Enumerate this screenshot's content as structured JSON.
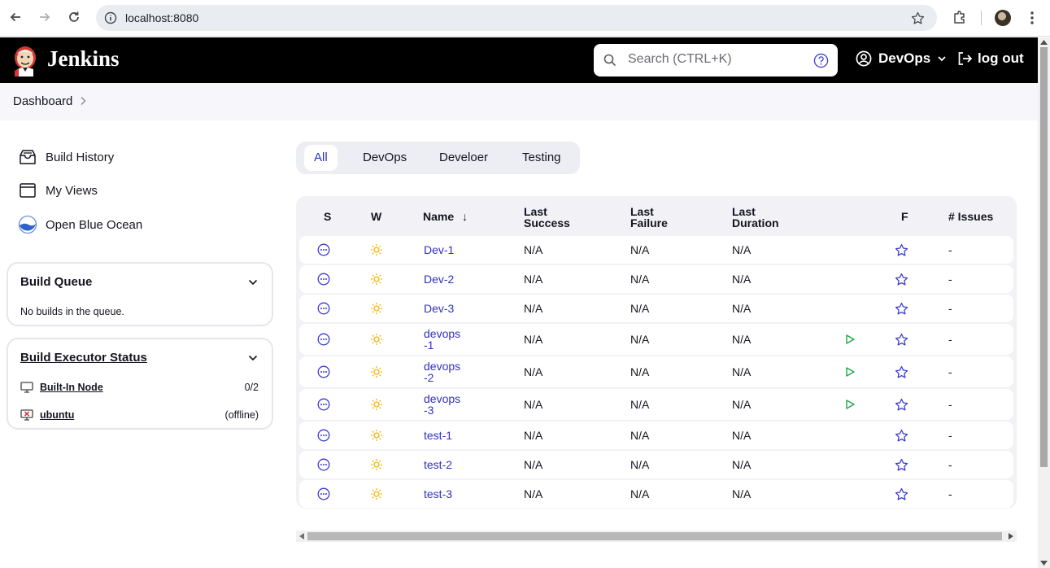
{
  "browser": {
    "url": "localhost:8080"
  },
  "header": {
    "title": "Jenkins",
    "search_placeholder": "Search (CTRL+K)",
    "user": "DevOps",
    "logout": "log out"
  },
  "breadcrumb": {
    "dashboard": "Dashboard"
  },
  "sidebar": {
    "tasks": [
      {
        "label": "Build History",
        "icon": "build-history-icon"
      },
      {
        "label": "My Views",
        "icon": "window-icon"
      },
      {
        "label": "Open Blue Ocean",
        "icon": "blue-ocean-icon"
      }
    ],
    "build_queue": {
      "title": "Build Queue",
      "empty_text": "No builds in the queue."
    },
    "executors": {
      "title": "Build Executor Status",
      "nodes": [
        {
          "name": "Built-In Node",
          "value": "0/2",
          "icon": "computer-icon"
        },
        {
          "name": "ubuntu",
          "value": "(offline)",
          "icon": "computer-offline-icon"
        }
      ]
    }
  },
  "tabs": [
    "All",
    "DevOps",
    "Develoer",
    "Testing"
  ],
  "active_tab": "All",
  "table": {
    "headers": {
      "s": "S",
      "w": "W",
      "name": "Name",
      "sort": "↓",
      "last_success": [
        "Last",
        "Success"
      ],
      "last_failure": [
        "Last",
        "Failure"
      ],
      "last_duration": [
        "Last",
        "Duration"
      ],
      "f": "F",
      "issues": "# Issues"
    },
    "rows": [
      {
        "name": [
          "Dev-1"
        ],
        "last_success": "N/A",
        "last_failure": "N/A",
        "last_duration": "N/A",
        "issues": "-",
        "run": false
      },
      {
        "name": [
          "Dev-2"
        ],
        "last_success": "N/A",
        "last_failure": "N/A",
        "last_duration": "N/A",
        "issues": "-",
        "run": false
      },
      {
        "name": [
          "Dev-3"
        ],
        "last_success": "N/A",
        "last_failure": "N/A",
        "last_duration": "N/A",
        "issues": "-",
        "run": false
      },
      {
        "name": [
          "devops",
          "-1"
        ],
        "last_success": "N/A",
        "last_failure": "N/A",
        "last_duration": "N/A",
        "issues": "-",
        "run": true
      },
      {
        "name": [
          "devops",
          "-2"
        ],
        "last_success": "N/A",
        "last_failure": "N/A",
        "last_duration": "N/A",
        "issues": "-",
        "run": true
      },
      {
        "name": [
          "devops",
          "-3"
        ],
        "last_success": "N/A",
        "last_failure": "N/A",
        "last_duration": "N/A",
        "issues": "-",
        "run": true
      },
      {
        "name": [
          "test-1"
        ],
        "last_success": "N/A",
        "last_failure": "N/A",
        "last_duration": "N/A",
        "issues": "-",
        "run": false
      },
      {
        "name": [
          "test-2"
        ],
        "last_success": "N/A",
        "last_failure": "N/A",
        "last_duration": "N/A",
        "issues": "-",
        "run": false
      },
      {
        "name": [
          "test-3"
        ],
        "last_success": "N/A",
        "last_failure": "N/A",
        "last_duration": "N/A",
        "issues": "-",
        "run": false
      }
    ]
  },
  "colors": {
    "link": "#3030c5",
    "header_bg": "#000000",
    "run_green": "#1ea64b",
    "weather_sun": "#f0b400"
  }
}
